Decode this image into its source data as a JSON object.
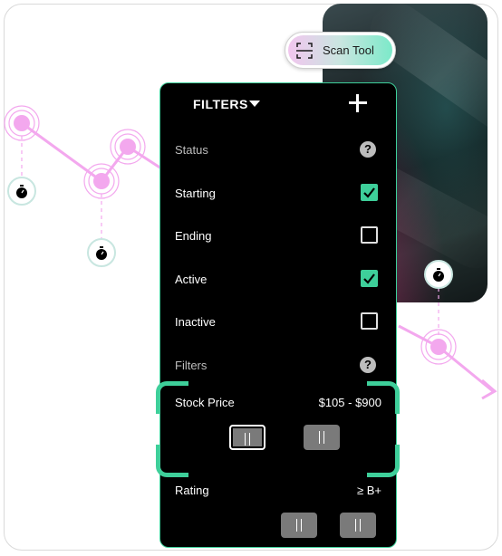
{
  "scan_tool": {
    "label": "Scan Tool",
    "icon": "scan-icon"
  },
  "filters": {
    "title": "FILTERS",
    "add_icon": "plus-icon",
    "status_section": {
      "label": "Status",
      "help_icon": "question-icon"
    },
    "statuses": [
      {
        "label": "Starting",
        "checked": true
      },
      {
        "label": "Ending",
        "checked": false
      },
      {
        "label": "Active",
        "checked": true
      },
      {
        "label": "Inactive",
        "checked": false
      }
    ],
    "filters_section": {
      "label": "Filters",
      "help_icon": "question-icon"
    },
    "stock_price": {
      "label": "Stock Price",
      "value": "$105 - $900"
    },
    "rating": {
      "label": "Rating",
      "value": "≥ B+"
    }
  },
  "colors": {
    "accent": "#3ecf9a",
    "panel_bg": "#000000",
    "timeline_pink": "#f3a8ee",
    "handle_gray": "#7a7a7a"
  }
}
